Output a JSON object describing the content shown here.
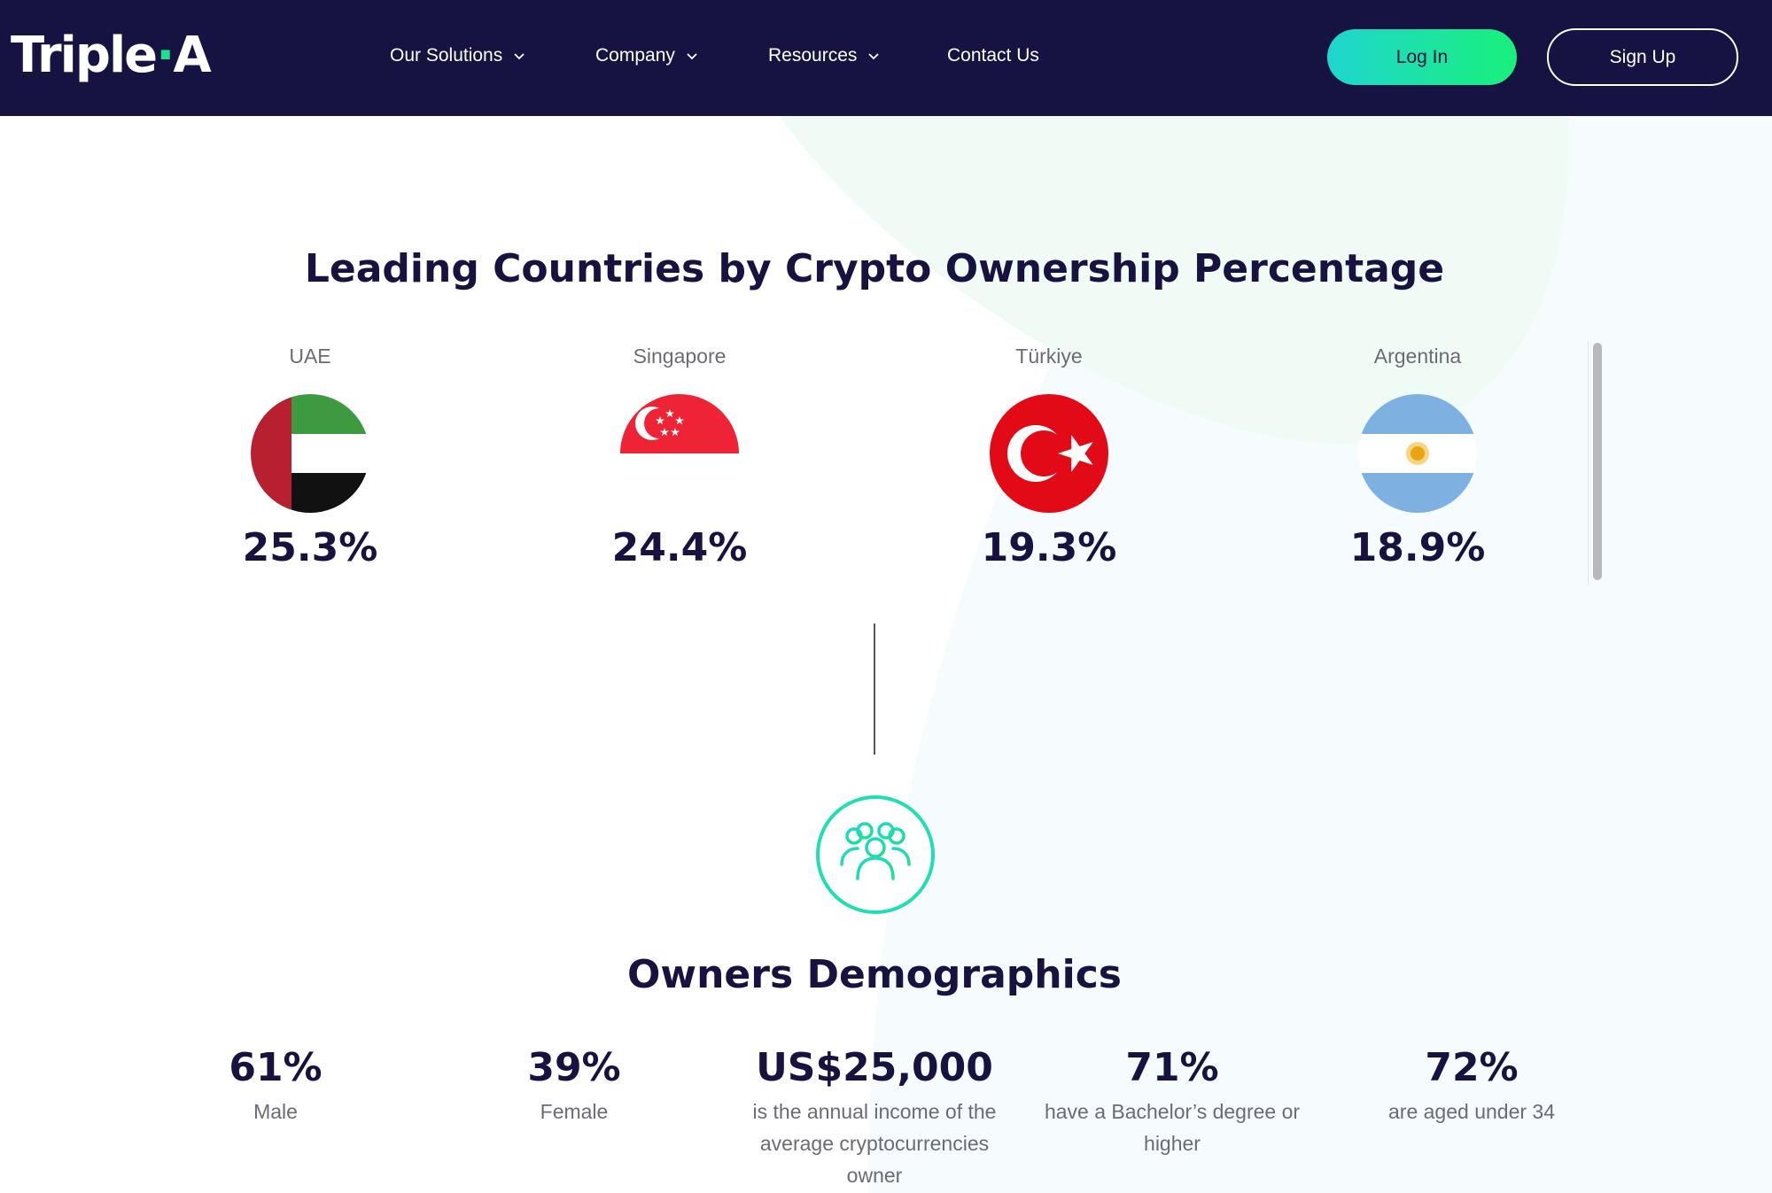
{
  "nav": {
    "logo_text_a": "Triple",
    "logo_dot": "·",
    "logo_text_b": "A",
    "items": [
      {
        "label": "Our Solutions",
        "has_dropdown": true
      },
      {
        "label": "Company",
        "has_dropdown": true
      },
      {
        "label": "Resources",
        "has_dropdown": true
      },
      {
        "label": "Contact Us",
        "has_dropdown": false
      }
    ],
    "login_label": "Log In",
    "signup_label": "Sign Up",
    "bg_color": "#161242",
    "accent_gradient": [
      "#1fd6d0",
      "#19f07a"
    ]
  },
  "countries_section": {
    "title": "Leading Countries by Crypto Ownership Percentage",
    "countries": [
      {
        "name": "UAE",
        "flag_icon": "uae-flag-icon",
        "percent": "25.3%"
      },
      {
        "name": "Singapore",
        "flag_icon": "singapore-flag-icon",
        "percent": "24.4%"
      },
      {
        "name": "Türkiye",
        "flag_icon": "turkey-flag-icon",
        "percent": "19.3%"
      },
      {
        "name": "Argentina",
        "flag_icon": "argentina-flag-icon",
        "percent": "18.9%"
      }
    ]
  },
  "demographics": {
    "icon": "people-group-icon",
    "title": "Owners Demographics",
    "stats": [
      {
        "value": "61%",
        "desc_lines": [
          "Male"
        ]
      },
      {
        "value": "39%",
        "desc_lines": [
          "Female"
        ]
      },
      {
        "value": "US$25,000",
        "desc_lines": [
          "is the annual income of the",
          "average cryptocurrencies",
          "owner"
        ]
      },
      {
        "value": "71%",
        "desc_lines": [
          "have a Bachelor’s degree or",
          "higher"
        ]
      },
      {
        "value": "72%",
        "desc_lines": [
          "are aged under 34"
        ]
      }
    ]
  }
}
